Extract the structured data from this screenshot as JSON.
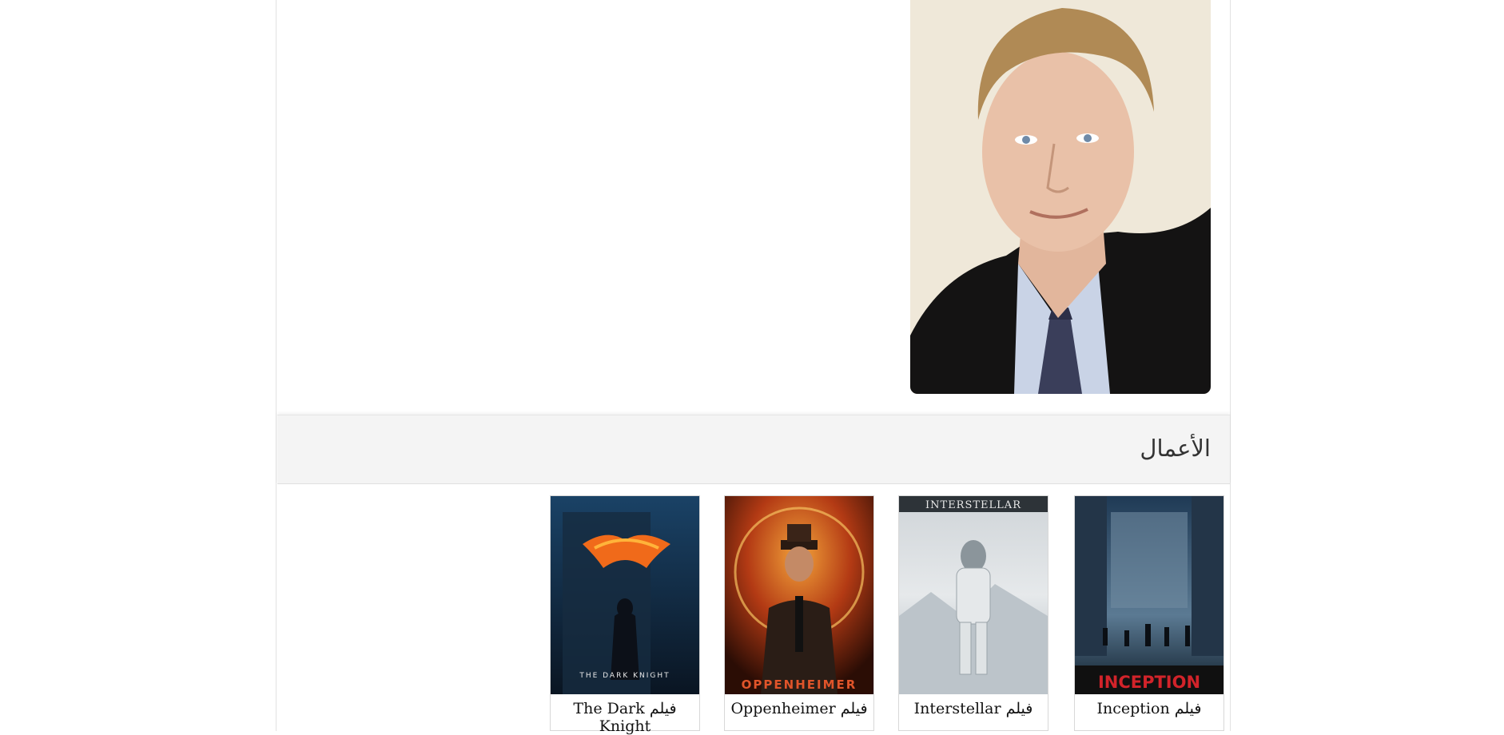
{
  "person": {
    "photo_alt": "portrait-photo"
  },
  "works": {
    "title": "الأعمال",
    "items": [
      {
        "caption": "فيلم Inception",
        "poster_text": "INCEPTION"
      },
      {
        "caption": "فيلم Interstellar",
        "poster_text": "INTERSTELLAR"
      },
      {
        "caption": "فيلم Oppenheimer",
        "poster_text": "OPPENHEIMER"
      },
      {
        "caption": "فيلم The Dark Knight",
        "poster_text": "THE DARK KNIGHT"
      }
    ]
  },
  "colors": {
    "header_bg": "#f4f4f4",
    "inception_title": "#d2232a",
    "oppenheimer_title": "#e0542a"
  }
}
